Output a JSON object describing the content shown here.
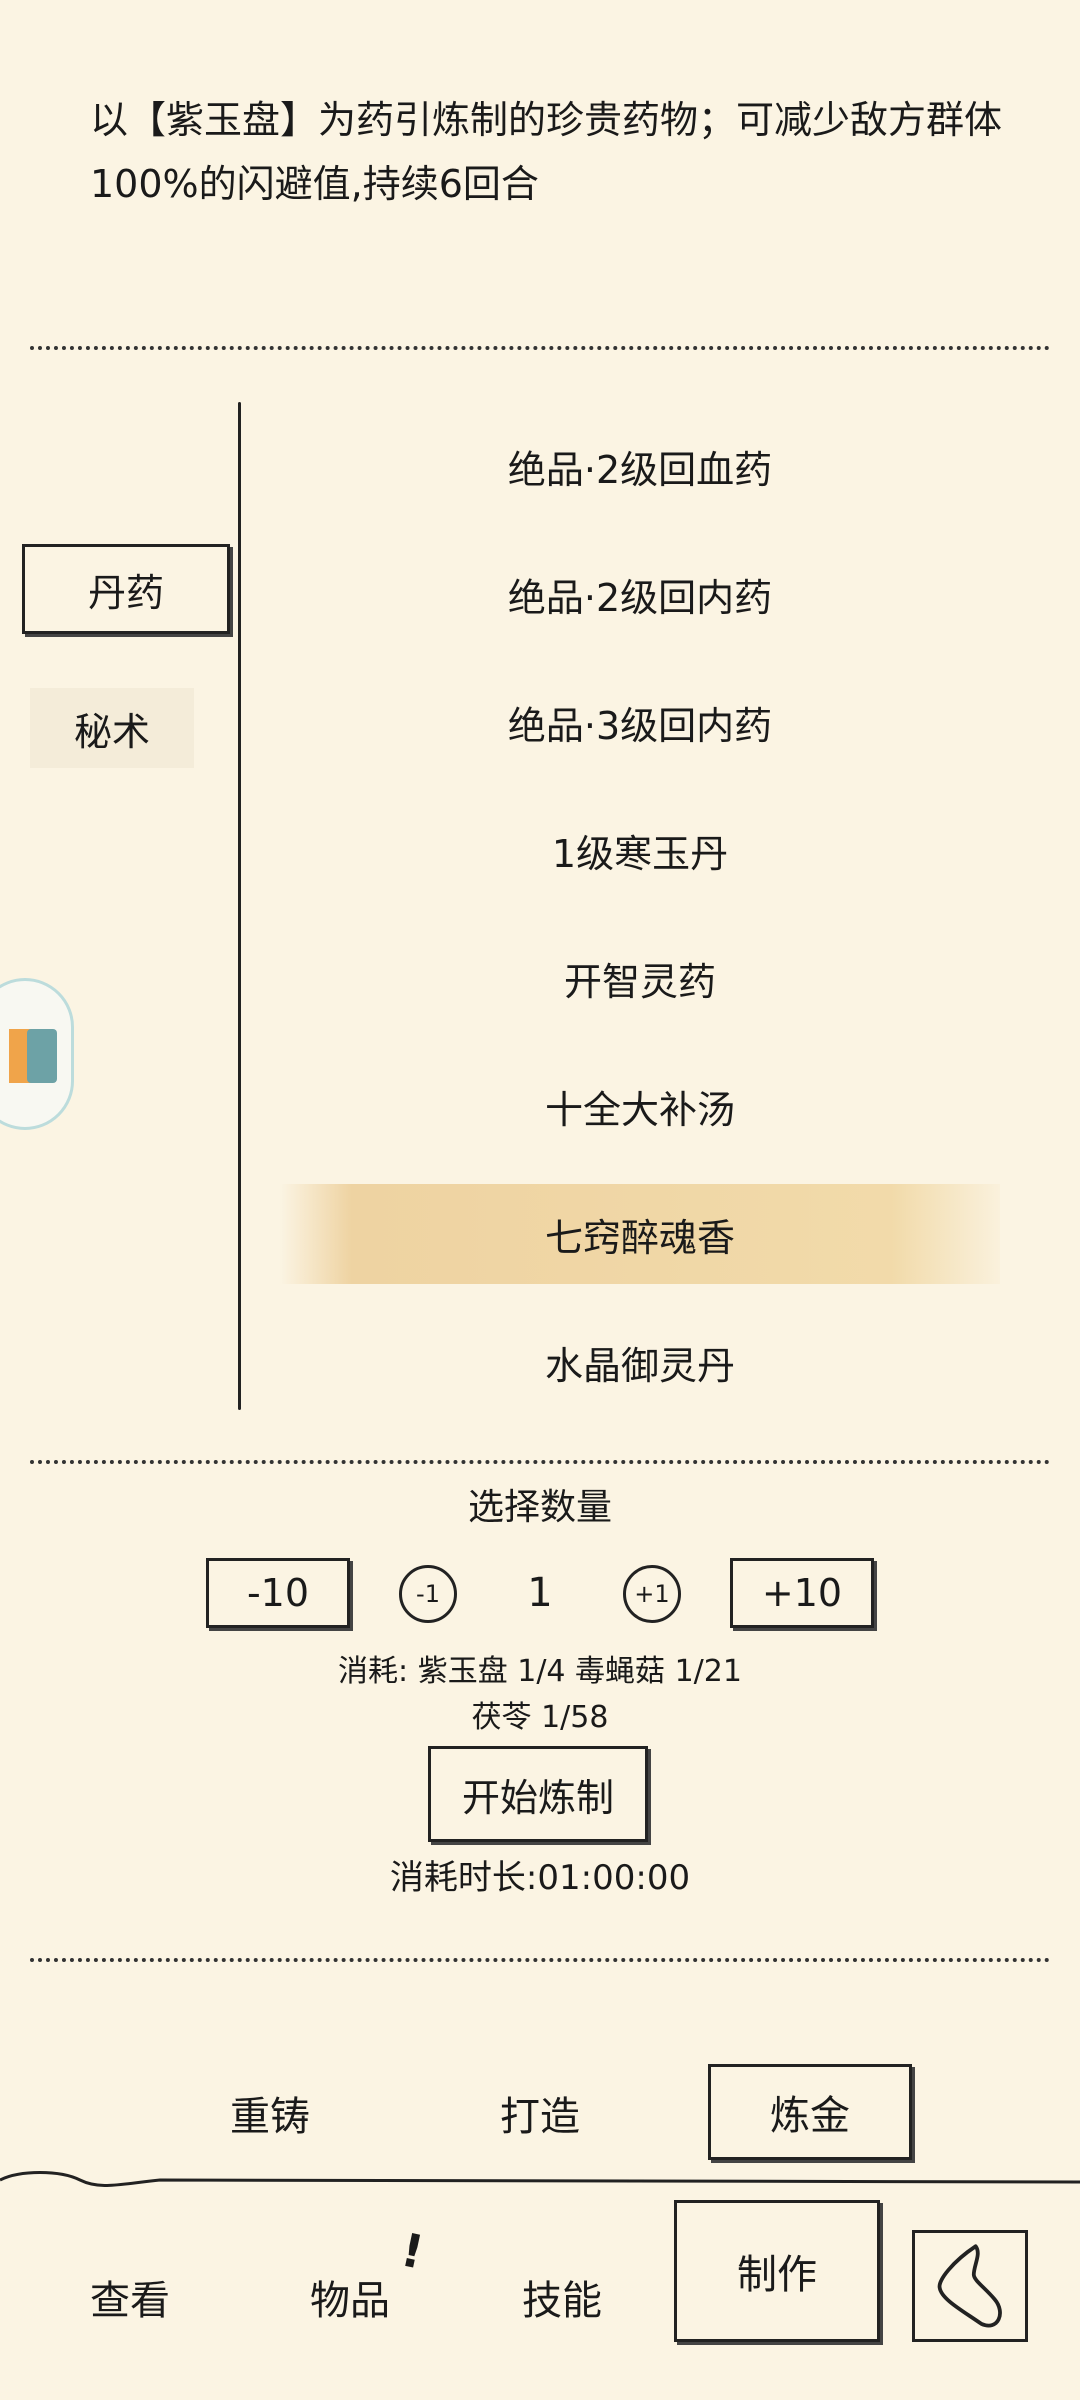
{
  "description": "以【紫玉盘】为药引炼制的珍贵药物；可减少敌方群体100%的闪避值,持续6回合",
  "categories": [
    {
      "label": "丹药",
      "selected": true
    },
    {
      "label": "秘术",
      "selected": false
    }
  ],
  "recipes": [
    {
      "label": "绝品·2级回血药"
    },
    {
      "label": "绝品·2级回内药"
    },
    {
      "label": "绝品·3级回内药"
    },
    {
      "label": "1级寒玉丹"
    },
    {
      "label": "开智灵药"
    },
    {
      "label": "十全大补汤"
    },
    {
      "label": "七窍醉魂香",
      "selected": true
    },
    {
      "label": "水晶御灵丹"
    }
  ],
  "quantity": {
    "title": "选择数量",
    "minus10": "-10",
    "minus1": "-1",
    "value": "1",
    "plus1": "+1",
    "plus10": "+10"
  },
  "cost": {
    "line1": "消耗: 紫玉盘  1/4    毒蝇菇  1/21",
    "line2": "茯苓  1/58"
  },
  "start_button": "开始炼制",
  "duration": "消耗时长:01:00:00",
  "craft_tabs": [
    {
      "label": "重铸"
    },
    {
      "label": "打造"
    },
    {
      "label": "炼金",
      "selected": true
    }
  ],
  "bottom_nav": [
    {
      "label": "查看"
    },
    {
      "label": "物品",
      "badge": "!"
    },
    {
      "label": "技能"
    },
    {
      "label": "制作",
      "selected": true
    }
  ],
  "icons": {
    "back": "back-arrow-icon",
    "side": "app-logo-icon"
  }
}
